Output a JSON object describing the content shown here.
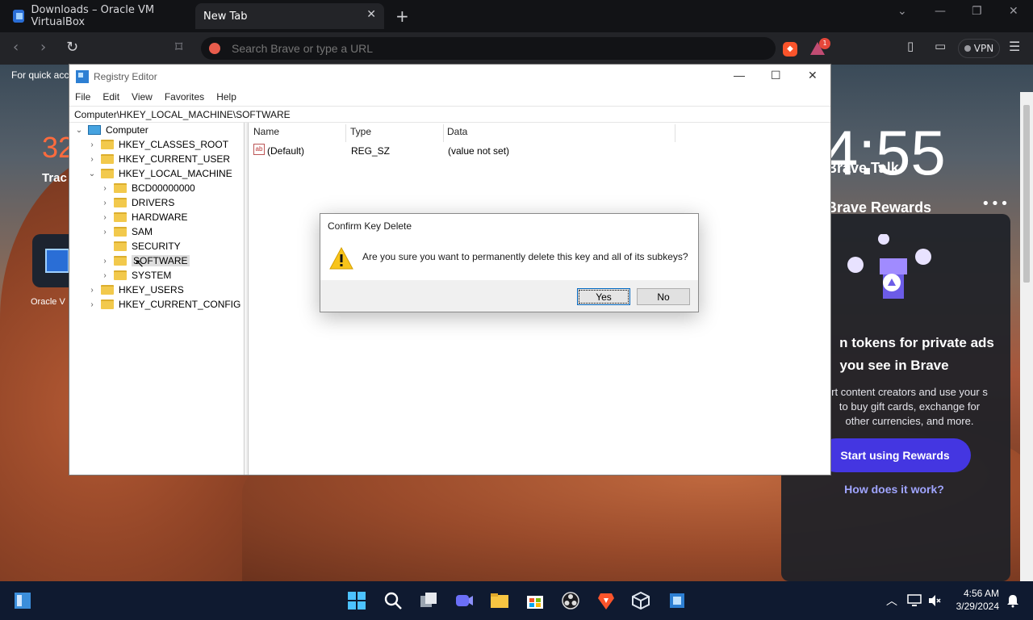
{
  "browser": {
    "tabs": [
      {
        "label": "Downloads – Oracle VM VirtualBox"
      },
      {
        "label": "New Tab"
      }
    ],
    "url_placeholder": "Search Brave or type a URL",
    "rewards_badge": "1",
    "vpn_label": "VPN"
  },
  "ntp": {
    "bookmark_hint": "For quick acc",
    "stat_number": "32",
    "stat_label": "Trac",
    "tile_label": "Oracle V",
    "clock": "4:55",
    "talk_title": "Brave Talk",
    "rewards_title": "Brave Rewards",
    "earn_line1": "n tokens for private ads",
    "earn_line2": "you see in Brave",
    "desc": "rt content creators and use your s to buy gift cards, exchange for other currencies, and more.",
    "start_button": "Start using Rewards",
    "how_link": "How does it work?"
  },
  "regedit": {
    "title": "Registry Editor",
    "menu": [
      "File",
      "Edit",
      "View",
      "Favorites",
      "Help"
    ],
    "address": "Computer\\HKEY_LOCAL_MACHINE\\SOFTWARE",
    "tree": [
      {
        "label": "Computer"
      },
      {
        "label": "HKEY_CLASSES_ROOT"
      },
      {
        "label": "HKEY_CURRENT_USER"
      },
      {
        "label": "HKEY_LOCAL_MACHINE"
      },
      {
        "label": "BCD00000000"
      },
      {
        "label": "DRIVERS"
      },
      {
        "label": "HARDWARE"
      },
      {
        "label": "SAM"
      },
      {
        "label": "SECURITY"
      },
      {
        "label": "SOFTWARE"
      },
      {
        "label": "SYSTEM"
      },
      {
        "label": "HKEY_USERS"
      },
      {
        "label": "HKEY_CURRENT_CONFIG"
      }
    ],
    "columns": [
      "Name",
      "Type",
      "Data"
    ],
    "values": [
      {
        "name": "(Default)",
        "type": "REG_SZ",
        "data": "(value not set)"
      }
    ]
  },
  "dialog": {
    "title": "Confirm Key Delete",
    "message": "Are you sure you want to permanently delete this key and all of its subkeys?",
    "yes": "Yes",
    "no": "No"
  },
  "taskbar": {
    "time": "4:56 AM",
    "date": "3/29/2024"
  }
}
